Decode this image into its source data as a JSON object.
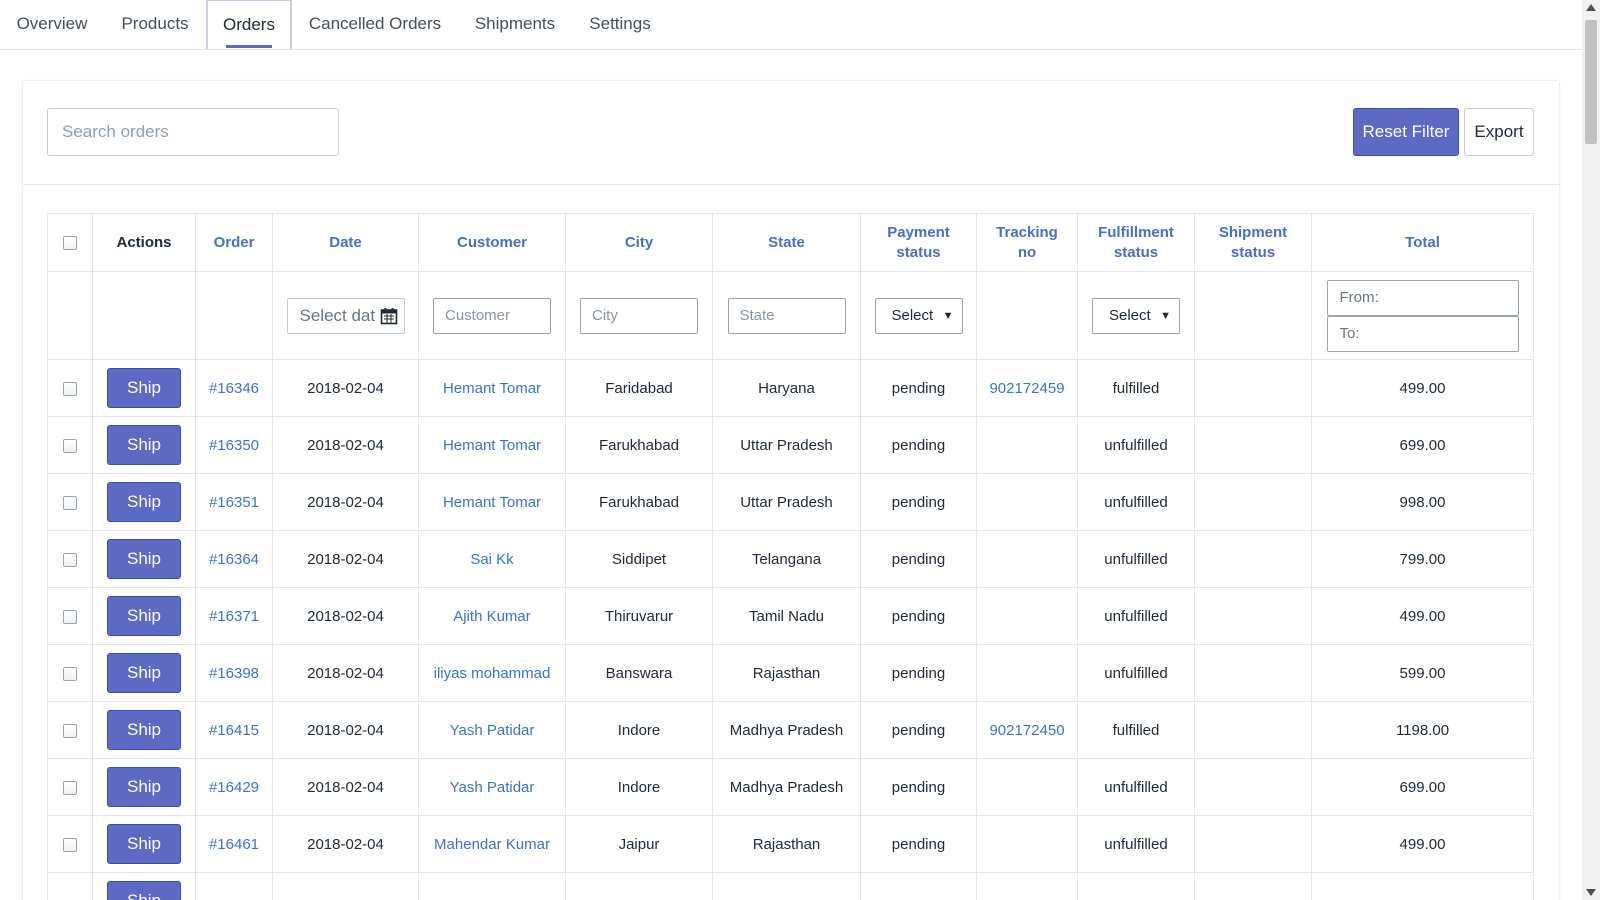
{
  "tabs": [
    "Overview",
    "Products",
    "Orders",
    "Cancelled Orders",
    "Shipments",
    "Settings"
  ],
  "active_tab": "Orders",
  "toolbar": {
    "search_placeholder": "Search orders",
    "reset_label": "Reset Filter",
    "export_label": "Export"
  },
  "table": {
    "headers": {
      "actions": "Actions",
      "order": "Order",
      "date": "Date",
      "customer": "Customer",
      "city": "City",
      "state": "State",
      "payment1": "Payment",
      "payment2": "status",
      "tracking1": "Tracking",
      "tracking2": "no",
      "fulfillment1": "Fulfillment",
      "fulfillment2": "status",
      "shipment1": "Shipment",
      "shipment2": "status",
      "total": "Total"
    },
    "filters": {
      "date_placeholder": "Select dat",
      "customer_placeholder": "Customer",
      "city_placeholder": "City",
      "state_placeholder": "State",
      "payment_select": "Select",
      "fulfillment_select": "Select",
      "total_from": "From:",
      "total_to": "To:"
    },
    "ship_label": "Ship",
    "rows": [
      {
        "order": "#16346",
        "date": "2018-02-04",
        "customer": "Hemant Tomar",
        "city": "Faridabad",
        "state": "Haryana",
        "payment": "pending",
        "tracking": "902172459",
        "fulfillment": "fulfilled",
        "shipment": "",
        "total": "499.00"
      },
      {
        "order": "#16350",
        "date": "2018-02-04",
        "customer": "Hemant Tomar",
        "city": "Farukhabad",
        "state": "Uttar Pradesh",
        "payment": "pending",
        "tracking": "",
        "fulfillment": "unfulfilled",
        "shipment": "",
        "total": "699.00"
      },
      {
        "order": "#16351",
        "date": "2018-02-04",
        "customer": "Hemant Tomar",
        "city": "Farukhabad",
        "state": "Uttar Pradesh",
        "payment": "pending",
        "tracking": "",
        "fulfillment": "unfulfilled",
        "shipment": "",
        "total": "998.00"
      },
      {
        "order": "#16364",
        "date": "2018-02-04",
        "customer": "Sai Kk",
        "city": "Siddipet",
        "state": "Telangana",
        "payment": "pending",
        "tracking": "",
        "fulfillment": "unfulfilled",
        "shipment": "",
        "total": "799.00"
      },
      {
        "order": "#16371",
        "date": "2018-02-04",
        "customer": "Ajith Kumar",
        "city": "Thiruvarur",
        "state": "Tamil Nadu",
        "payment": "pending",
        "tracking": "",
        "fulfillment": "unfulfilled",
        "shipment": "",
        "total": "499.00"
      },
      {
        "order": "#16398",
        "date": "2018-02-04",
        "customer": "iliyas mohammad",
        "city": "Banswara",
        "state": "Rajasthan",
        "payment": "pending",
        "tracking": "",
        "fulfillment": "unfulfilled",
        "shipment": "",
        "total": "599.00"
      },
      {
        "order": "#16415",
        "date": "2018-02-04",
        "customer": "Yash Patidar",
        "city": "Indore",
        "state": "Madhya Pradesh",
        "payment": "pending",
        "tracking": "902172450",
        "fulfillment": "fulfilled",
        "shipment": "",
        "total": "1198.00"
      },
      {
        "order": "#16429",
        "date": "2018-02-04",
        "customer": "Yash Patidar",
        "city": "Indore",
        "state": "Madhya Pradesh",
        "payment": "pending",
        "tracking": "",
        "fulfillment": "unfulfilled",
        "shipment": "",
        "total": "699.00"
      },
      {
        "order": "#16461",
        "date": "2018-02-04",
        "customer": "Mahendar Kumar",
        "city": "Jaipur",
        "state": "Rajasthan",
        "payment": "pending",
        "tracking": "",
        "fulfillment": "unfulfilled",
        "shipment": "",
        "total": "499.00"
      }
    ]
  },
  "colors": {
    "accent": "#5c6ac4",
    "link": "#3b73c6",
    "header_text": "#4a6fc1"
  },
  "icons": [
    "calendar-icon",
    "chevron-down-icon",
    "scroll-up-arrow",
    "scroll-down-arrow"
  ]
}
